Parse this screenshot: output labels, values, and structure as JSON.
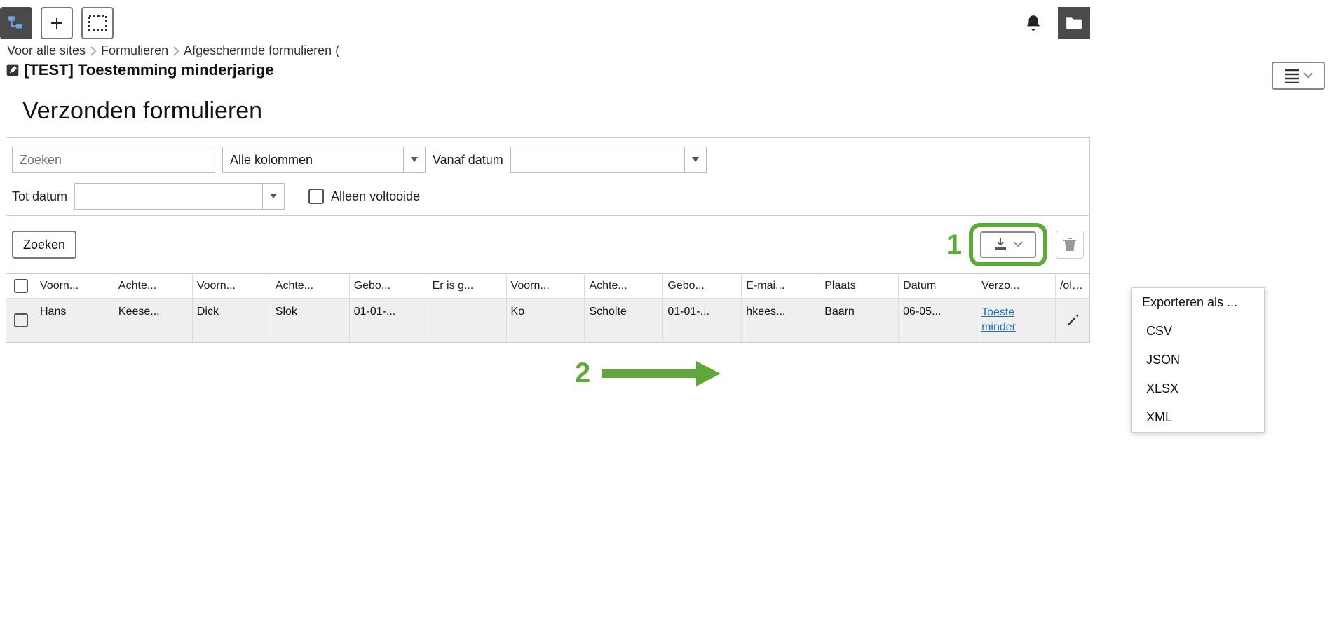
{
  "breadcrumb": {
    "items": [
      "Voor alle sites",
      "Formulieren",
      "Afgeschermde formulieren ("
    ]
  },
  "page": {
    "title": "[TEST] Toestemming minderjarige",
    "section_title": "Verzonden formulieren"
  },
  "filters": {
    "search_placeholder": "Zoeken",
    "column_select_value": "Alle kolommen",
    "from_date_label": "Vanaf datum",
    "to_date_label": "Tot datum",
    "only_completed_label": "Alleen voltooide",
    "search_button": "Zoeken"
  },
  "annotations": {
    "one": "1",
    "two": "2"
  },
  "exportMenu": {
    "title": "Exporteren als ...",
    "options": [
      "CSV",
      "JSON",
      "XLSX",
      "XML"
    ]
  },
  "table": {
    "headers": [
      "Voorn...",
      "Achte...",
      "Voorn...",
      "Achte...",
      "Gebo...",
      "Er is g...",
      "Voorn...",
      "Achte...",
      "Gebo...",
      "E-mai...",
      "Plaats",
      "Datum",
      "Verzo...",
      "/olto..."
    ],
    "rows": [
      {
        "cells": [
          "Hans",
          "Keese...",
          "Dick",
          "Slok",
          "01-01-...",
          "",
          "Ko",
          "Scholte",
          "01-01-...",
          "hkees...",
          "Baarn",
          "06-05..."
        ],
        "link": "Toeste minder",
        "pencil": true
      }
    ]
  }
}
